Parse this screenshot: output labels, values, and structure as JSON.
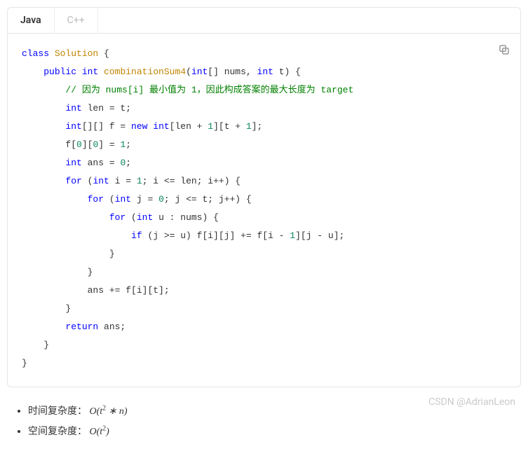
{
  "tabs": {
    "active": "Java",
    "inactive": "C++"
  },
  "code": {
    "lines": [
      {
        "indent": 0,
        "segs": [
          {
            "t": "class ",
            "c": "tok-keyword"
          },
          {
            "t": "Solution",
            "c": "tok-class"
          },
          {
            "t": " {",
            "c": ""
          }
        ]
      },
      {
        "indent": 1,
        "segs": [
          {
            "t": "public ",
            "c": "tok-keyword"
          },
          {
            "t": "int ",
            "c": "tok-type"
          },
          {
            "t": "combinationSum4",
            "c": "tok-method"
          },
          {
            "t": "(",
            "c": ""
          },
          {
            "t": "int",
            "c": "tok-type"
          },
          {
            "t": "[] nums, ",
            "c": ""
          },
          {
            "t": "int",
            "c": "tok-type"
          },
          {
            "t": " t) {",
            "c": ""
          }
        ]
      },
      {
        "indent": 2,
        "segs": [
          {
            "t": "// 因为 nums[i] 最小值为 1，因此构成答案的最大长度为 target",
            "c": "tok-comment"
          }
        ]
      },
      {
        "indent": 2,
        "segs": [
          {
            "t": "int",
            "c": "tok-type"
          },
          {
            "t": " len = t;",
            "c": ""
          }
        ]
      },
      {
        "indent": 2,
        "segs": [
          {
            "t": "int",
            "c": "tok-type"
          },
          {
            "t": "[][] f = ",
            "c": ""
          },
          {
            "t": "new ",
            "c": "tok-keyword"
          },
          {
            "t": "int",
            "c": "tok-type"
          },
          {
            "t": "[len + ",
            "c": ""
          },
          {
            "t": "1",
            "c": "tok-num"
          },
          {
            "t": "][t + ",
            "c": ""
          },
          {
            "t": "1",
            "c": "tok-num"
          },
          {
            "t": "];",
            "c": ""
          }
        ]
      },
      {
        "indent": 2,
        "segs": [
          {
            "t": "f[",
            "c": ""
          },
          {
            "t": "0",
            "c": "tok-num"
          },
          {
            "t": "][",
            "c": ""
          },
          {
            "t": "0",
            "c": "tok-num"
          },
          {
            "t": "] = ",
            "c": ""
          },
          {
            "t": "1",
            "c": "tok-num"
          },
          {
            "t": ";",
            "c": ""
          }
        ]
      },
      {
        "indent": 2,
        "segs": [
          {
            "t": "int",
            "c": "tok-type"
          },
          {
            "t": " ans = ",
            "c": ""
          },
          {
            "t": "0",
            "c": "tok-num"
          },
          {
            "t": ";",
            "c": ""
          }
        ]
      },
      {
        "indent": 2,
        "segs": [
          {
            "t": "for ",
            "c": "tok-keyword"
          },
          {
            "t": "(",
            "c": ""
          },
          {
            "t": "int",
            "c": "tok-type"
          },
          {
            "t": " i = ",
            "c": ""
          },
          {
            "t": "1",
            "c": "tok-num"
          },
          {
            "t": "; i <= len; i++) {",
            "c": ""
          }
        ]
      },
      {
        "indent": 3,
        "segs": [
          {
            "t": "for ",
            "c": "tok-keyword"
          },
          {
            "t": "(",
            "c": ""
          },
          {
            "t": "int",
            "c": "tok-type"
          },
          {
            "t": " j = ",
            "c": ""
          },
          {
            "t": "0",
            "c": "tok-num"
          },
          {
            "t": "; j <= t; j++) {",
            "c": ""
          }
        ]
      },
      {
        "indent": 4,
        "segs": [
          {
            "t": "for ",
            "c": "tok-keyword"
          },
          {
            "t": "(",
            "c": ""
          },
          {
            "t": "int",
            "c": "tok-type"
          },
          {
            "t": " u : nums) {",
            "c": ""
          }
        ]
      },
      {
        "indent": 5,
        "segs": [
          {
            "t": "if ",
            "c": "tok-keyword"
          },
          {
            "t": "(j >= u) f[i][j] += f[i - ",
            "c": ""
          },
          {
            "t": "1",
            "c": "tok-num"
          },
          {
            "t": "][j - u];",
            "c": ""
          }
        ]
      },
      {
        "indent": 4,
        "segs": [
          {
            "t": "}",
            "c": ""
          }
        ]
      },
      {
        "indent": 3,
        "segs": [
          {
            "t": "}",
            "c": ""
          }
        ]
      },
      {
        "indent": 3,
        "segs": [
          {
            "t": "ans += f[i][t];",
            "c": ""
          }
        ]
      },
      {
        "indent": 2,
        "segs": [
          {
            "t": "}",
            "c": ""
          }
        ]
      },
      {
        "indent": 2,
        "segs": [
          {
            "t": "return ",
            "c": "tok-keyword"
          },
          {
            "t": "ans;",
            "c": ""
          }
        ]
      },
      {
        "indent": 1,
        "segs": [
          {
            "t": "}",
            "c": ""
          }
        ]
      },
      {
        "indent": 0,
        "segs": [
          {
            "t": "}",
            "c": ""
          }
        ]
      }
    ]
  },
  "notes": {
    "time_label": "时间复杂度：",
    "time_math": "O(t² ∗ n)",
    "space_label": "空间复杂度：",
    "space_math": "O(t²)"
  },
  "watermark": "CSDN @AdrianLeon"
}
